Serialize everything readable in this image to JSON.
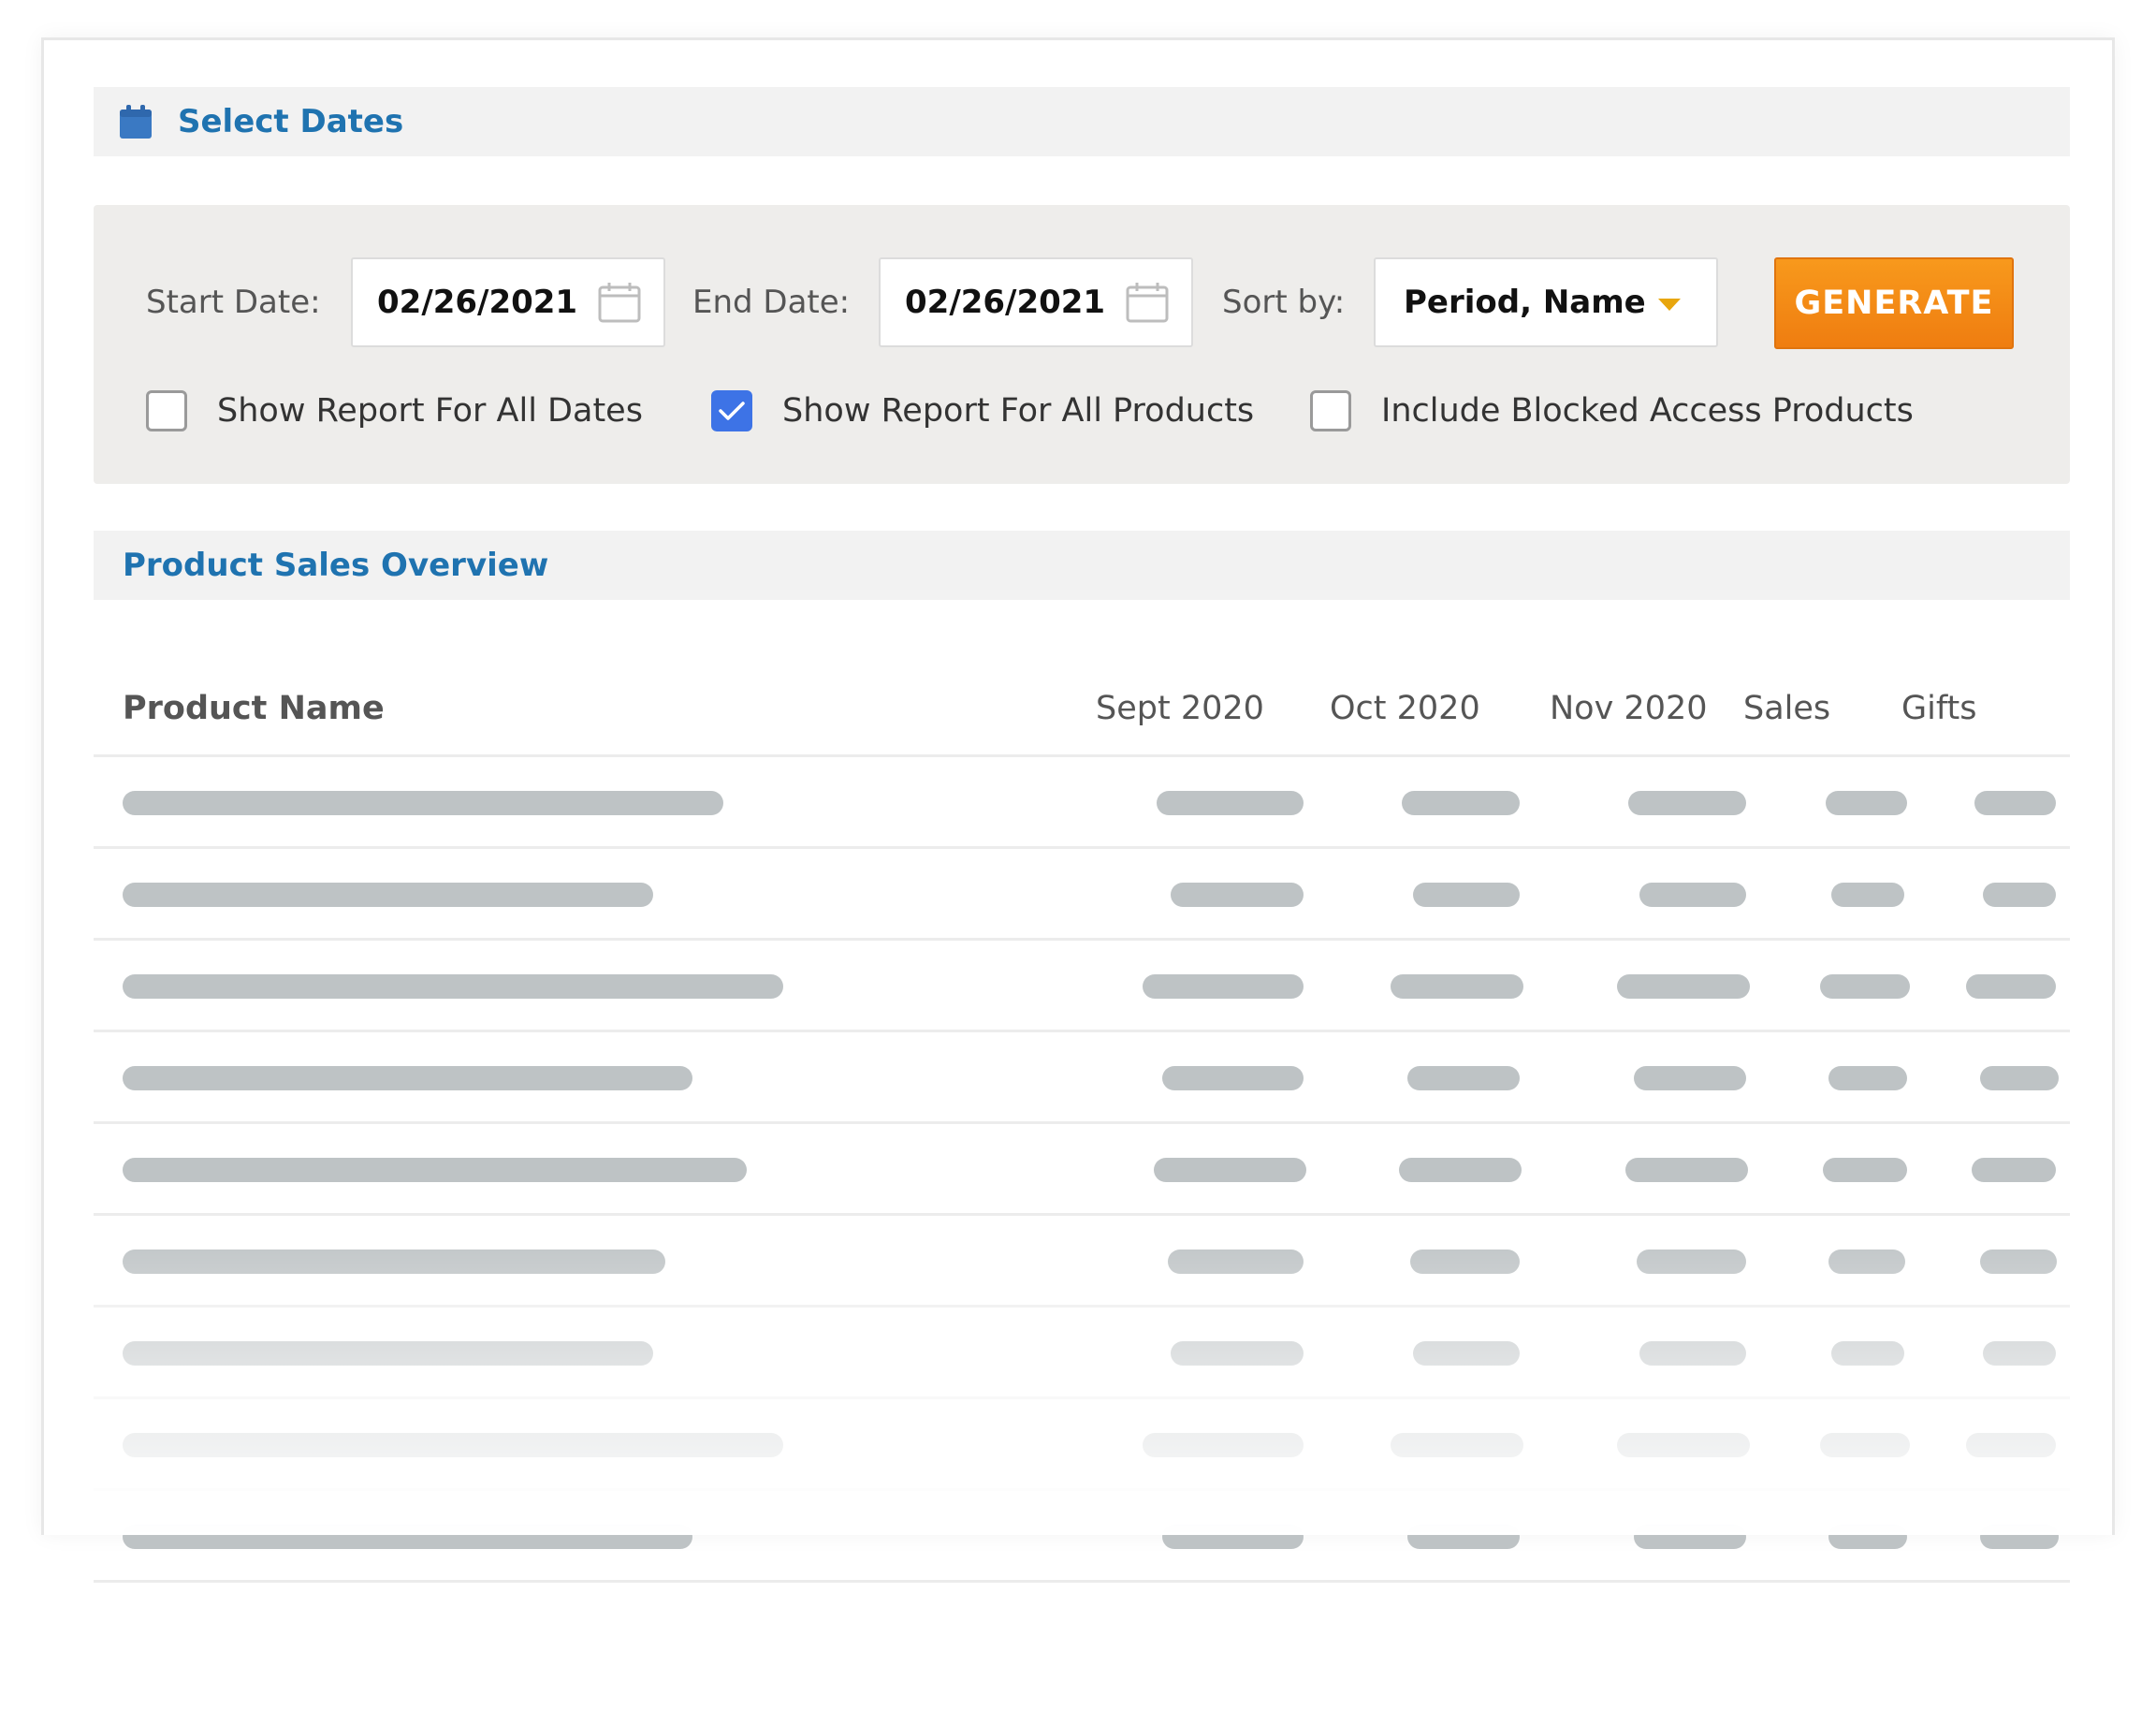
{
  "select_dates": {
    "title": "Select Dates",
    "icon": "calendar-icon"
  },
  "filters": {
    "start_label": "Start Date:",
    "start_value": "02/26/2021",
    "end_label": "End Date:",
    "end_value": "02/26/2021",
    "sort_label": "Sort by:",
    "sort_value": "Period, Name",
    "generate_label": "GENERATE",
    "checkboxes": [
      {
        "label": "Show Report For All Dates",
        "checked": false
      },
      {
        "label": "Show Report For All Products",
        "checked": true
      },
      {
        "label": "Include Blocked Access Products",
        "checked": false
      }
    ]
  },
  "overview": {
    "title": "Product Sales Overview",
    "columns": [
      "Product Name",
      "Sept 2020",
      "Oct 2020",
      "Nov 2020",
      "Sales",
      "Gifts"
    ],
    "placeholder_row_count": 9
  },
  "colors": {
    "accent_blue": "#1f73b0",
    "generate_orange": "#f58a16",
    "checkbox_blue": "#3d73e6",
    "skeleton_gray": "#bec3c5"
  }
}
